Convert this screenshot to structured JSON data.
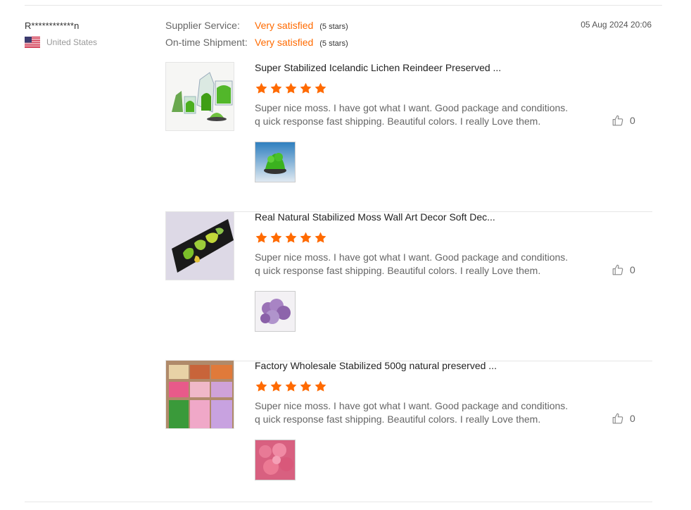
{
  "reviewer": {
    "name": "R************n",
    "country": "United States",
    "flag": "us-flag-icon"
  },
  "ratings": [
    {
      "label": "Supplier Service:",
      "value": "Very satisfied",
      "stars_note": "(5 stars)"
    },
    {
      "label": "On-time Shipment:",
      "value": "Very satisfied",
      "stars_note": "(5 stars)"
    }
  ],
  "date": "05 Aug 2024 20:06",
  "accent_color": "#ff6a00",
  "reviews": [
    {
      "title": "Super Stabilized Icelandic Lichen Reindeer Preserved ...",
      "rating": 5,
      "text": "Super nice moss. I have got what I want. Good package and conditions. q uick response fast shipping. Beautiful colors. I really Love them.",
      "likes": "0"
    },
    {
      "title": "Real Natural Stabilized Moss Wall Art Decor Soft Dec...",
      "rating": 5,
      "text": "Super nice moss. I have got what I want. Good package and conditions. q uick response fast shipping. Beautiful colors. I really Love them.",
      "likes": "0"
    },
    {
      "title": "Factory Wholesale Stabilized 500g natural preserved ...",
      "rating": 5,
      "text": "Super nice moss. I have got what I want. Good package and conditions. q uick response fast shipping. Beautiful colors. I really Love them.",
      "likes": "0"
    }
  ]
}
